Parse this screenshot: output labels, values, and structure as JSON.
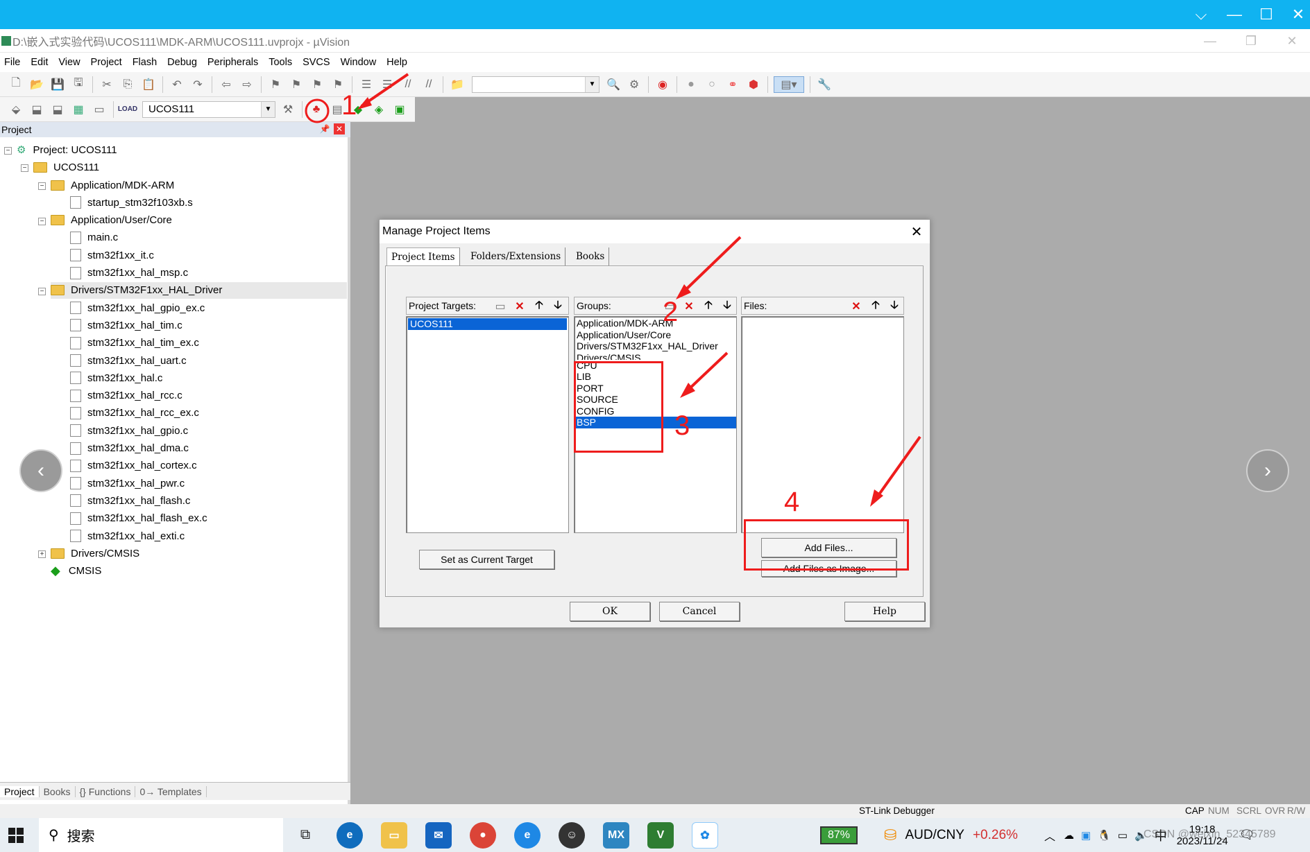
{
  "viewer": {
    "controls": [
      "⌵",
      "—",
      "☐",
      "✕"
    ]
  },
  "window": {
    "title": "D:\\嵌入式实验代码\\UCOS111\\MDK-ARM\\UCOS111.uvprojx - µVision",
    "menu": [
      "File",
      "Edit",
      "View",
      "Project",
      "Flash",
      "Debug",
      "Peripherals",
      "Tools",
      "SVCS",
      "Window",
      "Help"
    ],
    "target_combo": "UCOS111"
  },
  "project_pane": {
    "header": "Project",
    "root": "Project: UCOS111",
    "target": "UCOS111",
    "groups": [
      {
        "name": "Application/MDK-ARM",
        "files": [
          "startup_stm32f103xb.s"
        ]
      },
      {
        "name": "Application/User/Core",
        "files": [
          "main.c",
          "stm32f1xx_it.c",
          "stm32f1xx_hal_msp.c"
        ]
      },
      {
        "name": "Drivers/STM32F1xx_HAL_Driver",
        "files": [
          "stm32f1xx_hal_gpio_ex.c",
          "stm32f1xx_hal_tim.c",
          "stm32f1xx_hal_tim_ex.c",
          "stm32f1xx_hal_uart.c",
          "stm32f1xx_hal.c",
          "stm32f1xx_hal_rcc.c",
          "stm32f1xx_hal_rcc_ex.c",
          "stm32f1xx_hal_gpio.c",
          "stm32f1xx_hal_dma.c",
          "stm32f1xx_hal_cortex.c",
          "stm32f1xx_hal_pwr.c",
          "stm32f1xx_hal_flash.c",
          "stm32f1xx_hal_flash_ex.c",
          "stm32f1xx_hal_exti.c"
        ]
      },
      {
        "name": "Drivers/CMSIS",
        "files": []
      },
      {
        "name": "CMSIS",
        "files": []
      }
    ],
    "tabs": [
      "Project",
      "Books",
      "{} Functions",
      "0→ Templates"
    ]
  },
  "dialog": {
    "title": "Manage Project Items",
    "tabs": [
      "Project Items",
      "Folders/Extensions",
      "Books"
    ],
    "targets": {
      "label": "Project Targets:",
      "items": [
        "UCOS111"
      ],
      "selected": "UCOS111"
    },
    "groups": {
      "label": "Groups:",
      "items": [
        "Application/MDK-ARM",
        "Application/User/Core",
        "Drivers/STM32F1xx_HAL_Driver",
        "Drivers/CMSIS",
        "CPU",
        "LIB",
        "PORT",
        "SOURCE",
        "CONFIG",
        "BSP"
      ],
      "selected": "BSP"
    },
    "files": {
      "label": "Files:"
    },
    "set_current_target": "Set as Current Target",
    "add_files": "Add Files...",
    "add_files_image": "Add Files as Image...",
    "ok": "OK",
    "cancel": "Cancel",
    "help": "Help"
  },
  "annotations": {
    "n1": "1",
    "n2": "2",
    "n3": "3",
    "n4": "4",
    "color": "#ee1c1c"
  },
  "status": {
    "debugger": "ST-Link Debugger",
    "indicators": [
      "CAP",
      "NUM",
      "SCRL",
      "OVR",
      "R/W"
    ]
  },
  "taskbar": {
    "search": "搜索",
    "battery": "87%",
    "ticker_pair": "AUD/CNY",
    "ticker_change": "+0.26%",
    "ime": "中",
    "time": "19:18",
    "date": "2023/11/24",
    "watermark": "CSDN @weixin_52345789"
  }
}
